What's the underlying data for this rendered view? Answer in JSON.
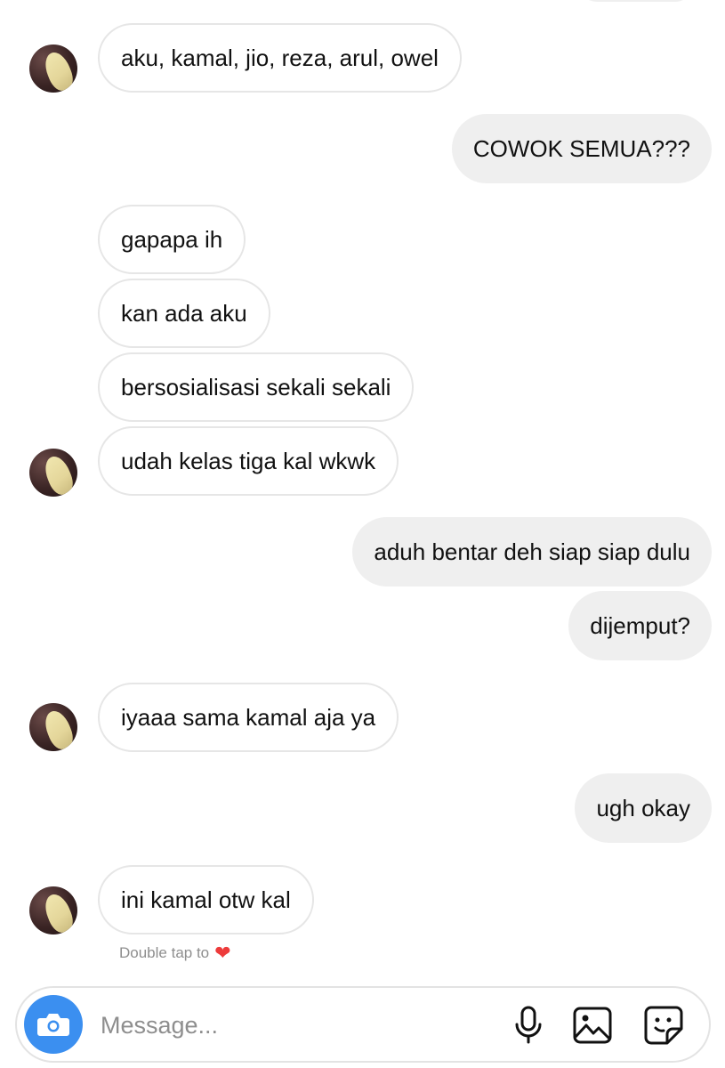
{
  "conversation": {
    "messages": [
      {
        "direction": "incoming",
        "text": "aku, kamal, jio, reza, arul, owel",
        "avatar": true
      },
      {
        "direction": "outgoing",
        "text": "COWOK SEMUA???"
      },
      {
        "direction": "incoming",
        "text": "gapapa ih",
        "avatar": false
      },
      {
        "direction": "incoming",
        "text": "kan ada aku",
        "avatar": false
      },
      {
        "direction": "incoming",
        "text": "bersosialisasi sekali sekali",
        "avatar": false
      },
      {
        "direction": "incoming",
        "text": "udah kelas tiga kal wkwk",
        "avatar": true
      },
      {
        "direction": "outgoing",
        "text": "aduh bentar deh siap siap dulu"
      },
      {
        "direction": "outgoing",
        "text": "dijemput?"
      },
      {
        "direction": "incoming",
        "text": "iyaaa sama kamal aja ya",
        "avatar": true
      },
      {
        "direction": "outgoing",
        "text": "ugh okay"
      },
      {
        "direction": "incoming",
        "text": "ini kamal otw kal",
        "avatar": true
      }
    ],
    "reaction_hint": "Double tap to",
    "reaction_hint_icon": "heart-icon"
  },
  "composer": {
    "placeholder": "Message...",
    "camera_icon": "camera-icon",
    "tools": [
      "microphone-icon",
      "gallery-icon",
      "sticker-icon"
    ],
    "camera_color": "#3b8ff0"
  },
  "colors": {
    "incoming_bubble": "#ffffff",
    "outgoing_bubble": "#efefef",
    "hint_text": "#8e8e8e",
    "heart": "#ed3b3b"
  }
}
